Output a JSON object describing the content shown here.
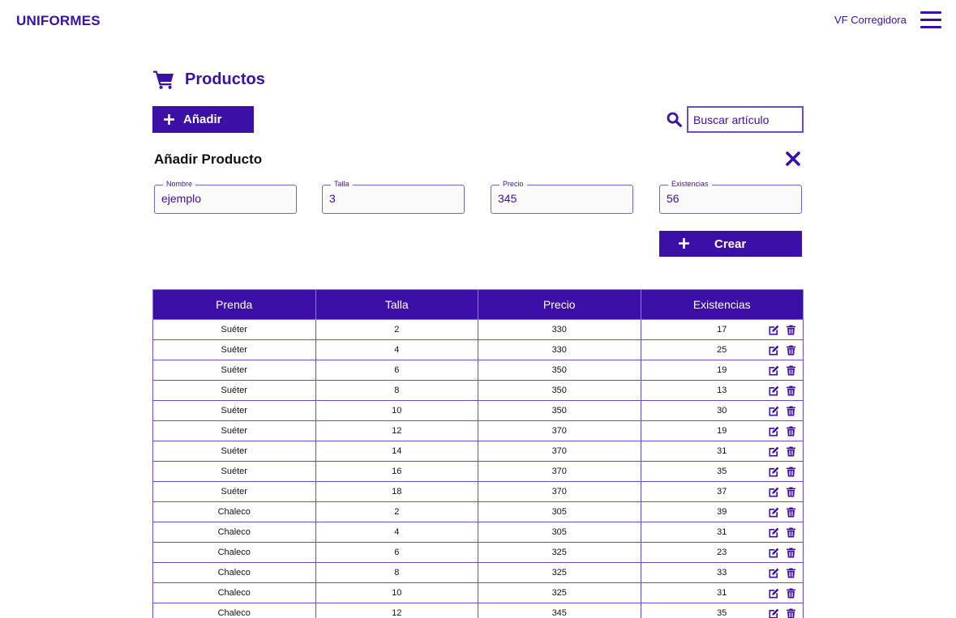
{
  "header": {
    "brand": "UNIFORMES",
    "user": "VF Corregidora",
    "icons": {
      "menu": "hamburger-menu-icon"
    }
  },
  "page": {
    "title": "Productos",
    "icon": "shopping-cart-icon"
  },
  "toolbar": {
    "add_label": "Añadir",
    "search_placeholder": "Buscar artículo",
    "search_icon": "search-icon"
  },
  "form": {
    "title": "Añadir Producto",
    "fields": {
      "nombre": {
        "label": "Nombre",
        "value": "ejemplo"
      },
      "talla": {
        "label": "Talla",
        "value": "3"
      },
      "precio": {
        "label": "Precio",
        "value": "345"
      },
      "existencias": {
        "label": "Existencias",
        "value": "56"
      }
    },
    "create_label": "Crear"
  },
  "table": {
    "headers": [
      "Prenda",
      "Talla",
      "Precio",
      "Existencias"
    ],
    "rows": [
      [
        "Suéter",
        "2",
        "330",
        "17"
      ],
      [
        "Suéter",
        "4",
        "330",
        "25"
      ],
      [
        "Suéter",
        "6",
        "350",
        "19"
      ],
      [
        "Suéter",
        "8",
        "350",
        "13"
      ],
      [
        "Suéter",
        "10",
        "350",
        "30"
      ],
      [
        "Suéter",
        "12",
        "370",
        "19"
      ],
      [
        "Suéter",
        "14",
        "370",
        "31"
      ],
      [
        "Suéter",
        "16",
        "370",
        "35"
      ],
      [
        "Suéter",
        "18",
        "370",
        "37"
      ],
      [
        "Chaleco",
        "2",
        "305",
        "39"
      ],
      [
        "Chaleco",
        "4",
        "305",
        "31"
      ],
      [
        "Chaleco",
        "6",
        "325",
        "23"
      ],
      [
        "Chaleco",
        "8",
        "325",
        "33"
      ],
      [
        "Chaleco",
        "10",
        "325",
        "31"
      ],
      [
        "Chaleco",
        "12",
        "345",
        "35"
      ]
    ],
    "row_icons": [
      "edit-icon",
      "trash-icon"
    ]
  },
  "colors": {
    "accent": "#3c0fa6",
    "border": "#6a4bd1",
    "text": "#111111",
    "background": "#ffffff"
  }
}
